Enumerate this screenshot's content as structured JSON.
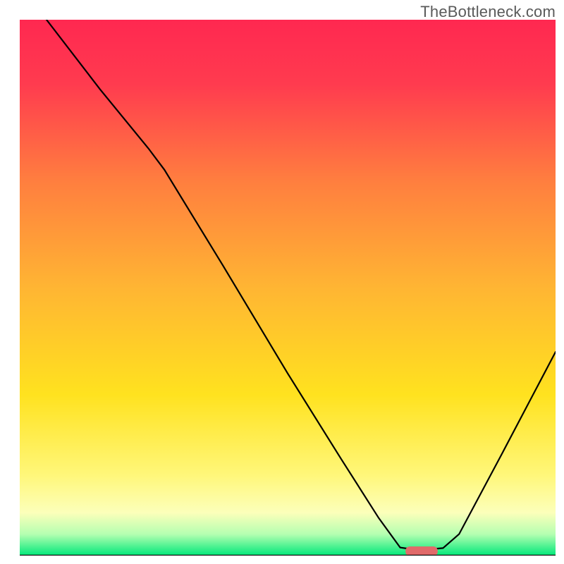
{
  "branding": {
    "watermark": "TheBottleneck.com"
  },
  "chart_data": {
    "type": "line",
    "title": "",
    "xlabel": "",
    "ylabel": "",
    "xlim": [
      0,
      100
    ],
    "ylim": [
      0,
      100
    ],
    "grid": false,
    "legend": false,
    "background": {
      "type": "vertical-gradient",
      "stops": [
        {
          "offset": 0,
          "color": "#ff2850"
        },
        {
          "offset": 0.12,
          "color": "#ff3b4f"
        },
        {
          "offset": 0.3,
          "color": "#ff7e3f"
        },
        {
          "offset": 0.5,
          "color": "#ffb533"
        },
        {
          "offset": 0.7,
          "color": "#ffe21f"
        },
        {
          "offset": 0.85,
          "color": "#fff77a"
        },
        {
          "offset": 0.92,
          "color": "#fcffba"
        },
        {
          "offset": 0.96,
          "color": "#b5ffb1"
        },
        {
          "offset": 1.0,
          "color": "#00e87a"
        }
      ]
    },
    "series": [
      {
        "name": "bottleneck-curve",
        "type": "path",
        "color": "#000000",
        "width": 2.2,
        "points": [
          {
            "x": 5,
            "y": 100
          },
          {
            "x": 15,
            "y": 87
          },
          {
            "x": 24,
            "y": 76
          },
          {
            "x": 27,
            "y": 72
          },
          {
            "x": 38,
            "y": 54
          },
          {
            "x": 50,
            "y": 34
          },
          {
            "x": 60,
            "y": 18
          },
          {
            "x": 67,
            "y": 7
          },
          {
            "x": 71,
            "y": 1.5
          },
          {
            "x": 73,
            "y": 1.2
          },
          {
            "x": 77,
            "y": 1.2
          },
          {
            "x": 79,
            "y": 1.4
          },
          {
            "x": 82,
            "y": 4
          },
          {
            "x": 90,
            "y": 19
          },
          {
            "x": 100,
            "y": 38
          }
        ]
      }
    ],
    "markers": [
      {
        "name": "optimum-marker",
        "shape": "capsule",
        "color": "#e16a6a",
        "x_center": 75,
        "y_center": 0.8,
        "width": 6,
        "height": 1.8
      }
    ],
    "baseline": {
      "color": "#000000",
      "width": 2.2,
      "y": 0
    }
  }
}
